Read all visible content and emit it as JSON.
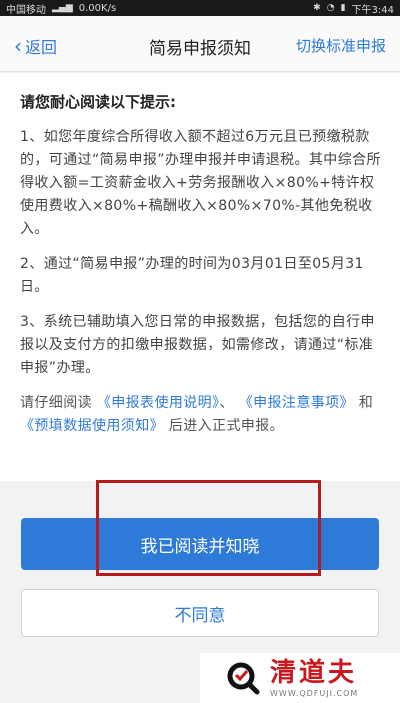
{
  "status_bar": {
    "carrier": "中国移动",
    "speed": "0.00K/s",
    "time": "下午3:44"
  },
  "nav": {
    "back_label": "返回",
    "title": "简易申报须知",
    "switch_label": "切换标准申报"
  },
  "notice": {
    "heading": "请您耐心阅读以下提示:",
    "item1": "1、如您年度综合所得收入额不超过6万元且已预缴税款的，可通过“简易申报”办理申报并申请退税。其中综合所得收入额=工资薪金收入+劳务报酬收入×80%+特许权使用费收入×80%+稿酬收入×80%×70%-其他免税收入。",
    "item2": "2、通过“简易申报”办理的时间为03月01日至05月31日。",
    "item3": "3、系统已辅助填入您日常的申报数据，包括您的自行申报以及支付方的扣缴申报数据，如需修改，请通过“标准申报”办理。",
    "links": {
      "prefix": "请仔细阅读",
      "link1": "《申报表使用说明》",
      "sep1": "、",
      "link2": "《申报注意事项》",
      "and": "和",
      "link3": "《预填数据使用须知》",
      "suffix": "后进入正式申报。"
    }
  },
  "buttons": {
    "agree": "我已阅读并知晓",
    "disagree": "不同意"
  },
  "watermark": {
    "name": "清道夫",
    "url": "WWW.QDFUJI.COM"
  },
  "colors": {
    "accent": "#2d7ad8",
    "highlight": "#b51d1d",
    "watermark": "#c8191f"
  }
}
